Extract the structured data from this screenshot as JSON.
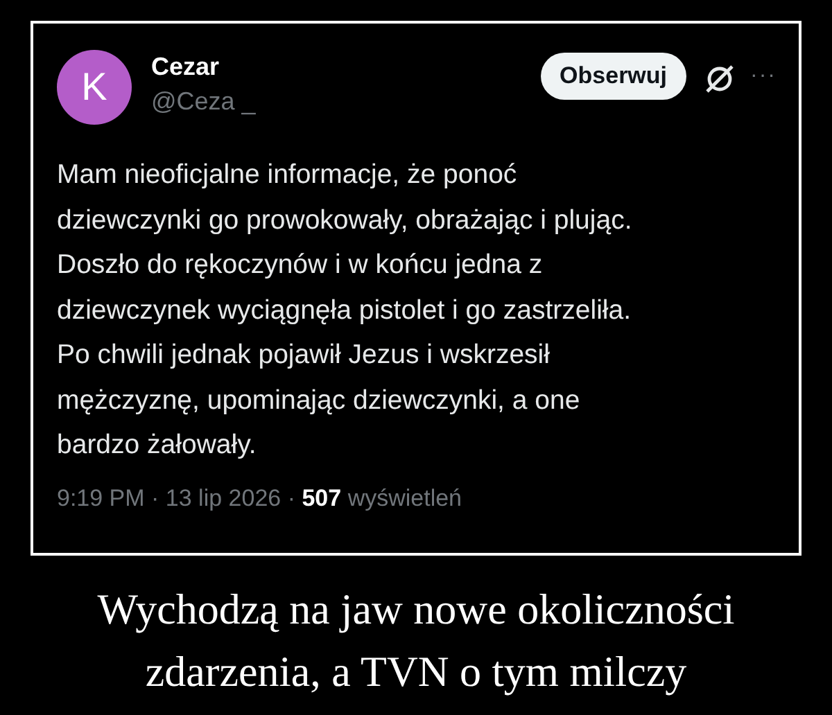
{
  "tweet": {
    "avatar_letter": "K",
    "name": "Cezar",
    "handle": "@Ceza _",
    "follow_button": "Obserwuj",
    "more_button": "···",
    "text": "Mam nieoficjalne informacje, że ponoć\ndziewczynki go prowokowały, obrażając i plując.\nDoszło do rękoczynów i w końcu jedna z\ndziewczynek wyciągnęła pistolet i go zastrzeliła.\nPo chwili jednak pojawił Jezus i wskrzesił\nmężczyznę, upominając dziewczynki, a one\nbardzo żałowały.",
    "time": "9:19 PM · 13 lip 2026 · ",
    "views_count": "507",
    "views_label": " wyświetleń"
  },
  "caption": "Wychodzą na jaw nowe okoliczności zdarzenia, a TVN o tym milczy"
}
